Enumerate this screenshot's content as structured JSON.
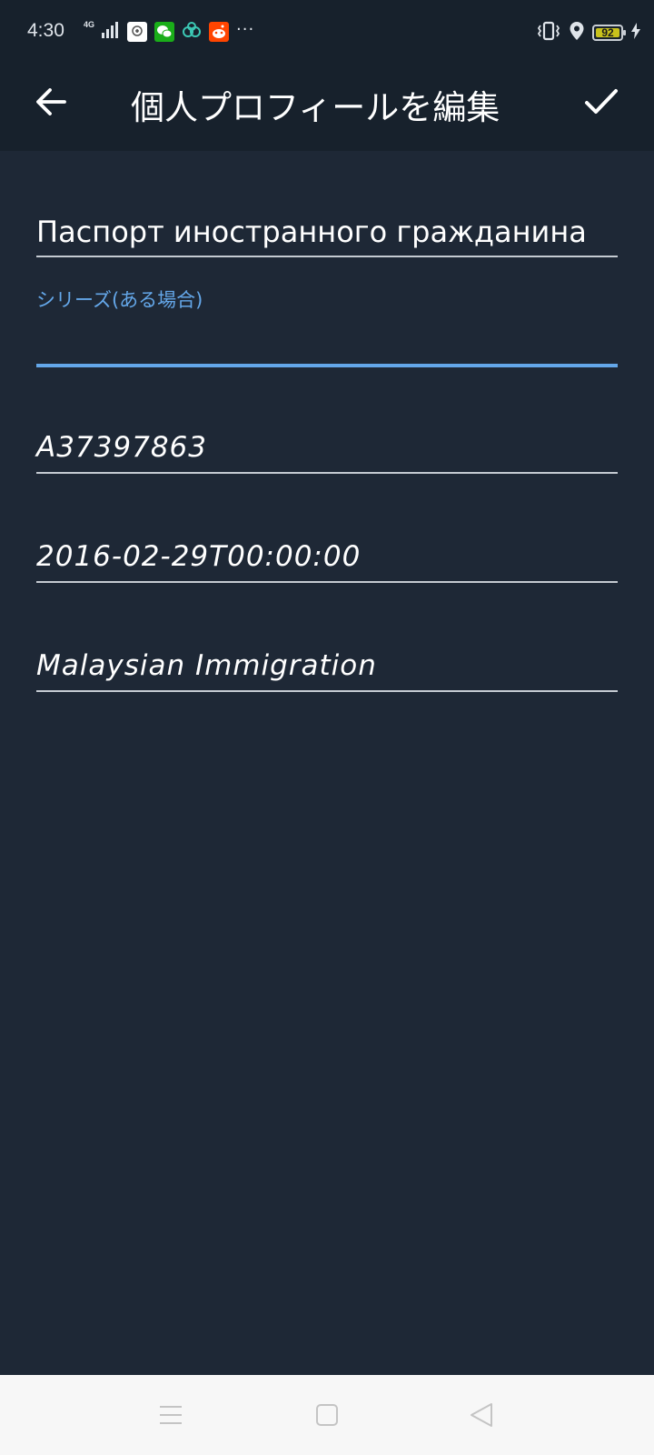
{
  "status_bar": {
    "time": "4:30",
    "network": "4G",
    "battery_level": "92",
    "app_icons": [
      "sim-toolkit-icon",
      "wechat-icon",
      "link-app-icon",
      "reddit-icon"
    ],
    "more_indicator": "···",
    "colors": {
      "wechat": "#1aad19",
      "reddit": "#ff4500",
      "link_app": "#3cc8b4",
      "battery_fill": "#c9c21c"
    }
  },
  "app_bar": {
    "title": "個人プロフィールを編集",
    "back_icon": "arrow-left-icon",
    "confirm_icon": "check-icon"
  },
  "form": {
    "fields": [
      {
        "label": "",
        "value": "Паспорт иностранного гражданина",
        "focused": false
      },
      {
        "label": "シリーズ(ある場合)",
        "value": "",
        "focused": true
      },
      {
        "label": "",
        "value": "A37397863",
        "focused": false
      },
      {
        "label": "",
        "value": "2016-02-29T00:00:00",
        "focused": false
      },
      {
        "label": "",
        "value": "Malaysian Immigration",
        "focused": false
      }
    ]
  },
  "nav_bar": {
    "buttons": [
      "menu-icon",
      "home-icon",
      "back-triangle-icon"
    ]
  },
  "theme": {
    "background": "#1e2836",
    "app_bar": "#17212c",
    "accent": "#64a7e9",
    "text": "#ffffff"
  }
}
